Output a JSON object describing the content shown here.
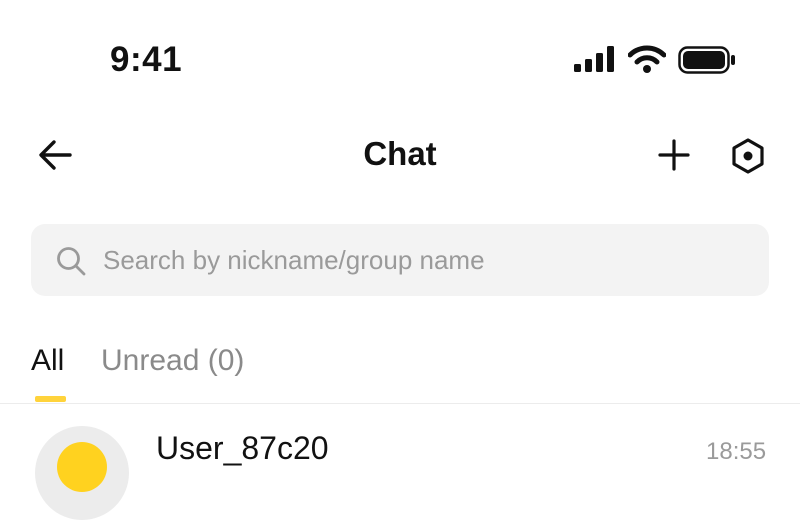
{
  "status_bar": {
    "time": "9:41",
    "icons": [
      "cellular-signal-icon",
      "wifi-icon",
      "battery-icon"
    ]
  },
  "header": {
    "title": "Chat",
    "icons": [
      "back-arrow-icon",
      "plus-icon",
      "settings-hex-icon"
    ]
  },
  "search": {
    "placeholder": "Search by nickname/group name",
    "value": ""
  },
  "tabs": [
    {
      "label": "All",
      "active": true
    },
    {
      "label": "Unread (0)",
      "active": false
    }
  ],
  "colors": {
    "accent": "#ffd33b",
    "search_bg": "#f3f3f3",
    "muted_text": "#8a8a8a"
  },
  "chats": [
    {
      "name": "User_87c20",
      "time": "18:55"
    }
  ]
}
